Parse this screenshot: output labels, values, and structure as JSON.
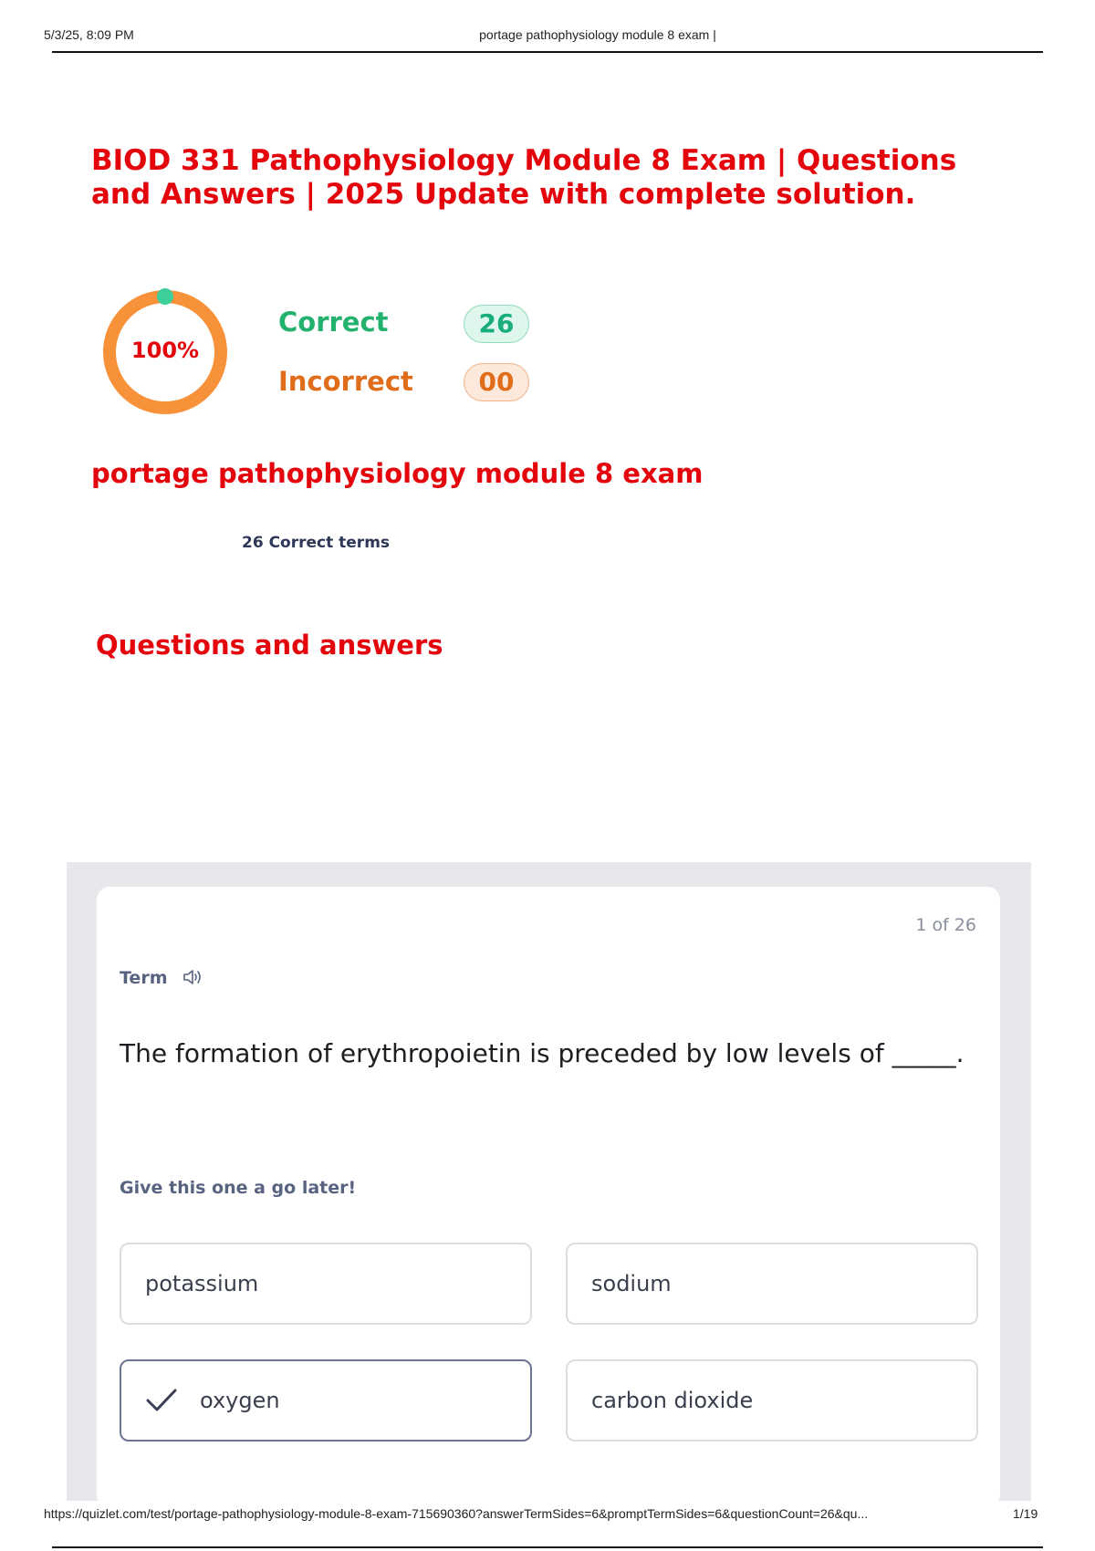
{
  "print_header": {
    "date": "5/3/25, 8:09 PM",
    "title": "portage pathophysiology module 8 exam |"
  },
  "document": {
    "title": "BIOD 331 Pathophysiology Module 8 Exam | Questions and Answers | 2025 Update with complete solution."
  },
  "score": {
    "percent_label": "100%",
    "percent_value": 100,
    "correct_label": "Correct",
    "correct_count": "26",
    "incorrect_label": "Incorrect",
    "incorrect_count": "00",
    "colors": {
      "ring": "#f7923a",
      "marker": "#3ccf9a",
      "correct": "#23b26d",
      "incorrect": "#e06d1b"
    }
  },
  "set": {
    "title": "portage pathophysiology module 8 exam",
    "terms_count": "26 Correct terms"
  },
  "section_heading": "Questions and answers",
  "card": {
    "counter": "1 of 26",
    "term_label": "Term",
    "speaker_icon": "speaker-icon",
    "question": "The formation of erythropoietin is preceded by low levels of _____.",
    "hint": "Give this one a go later!",
    "options": [
      {
        "label": "potassium",
        "selected": false
      },
      {
        "label": "sodium",
        "selected": false
      },
      {
        "label": "oxygen",
        "selected": true
      },
      {
        "label": "carbon dioxide",
        "selected": false
      }
    ]
  },
  "print_footer": {
    "url": "https://quizlet.com/test/portage-pathophysiology-module-8-exam-715690360?answerTermSides=6&promptTermSides=6&questionCount=26&qu...",
    "page": "1/19"
  },
  "accent_color": "#e3050b"
}
